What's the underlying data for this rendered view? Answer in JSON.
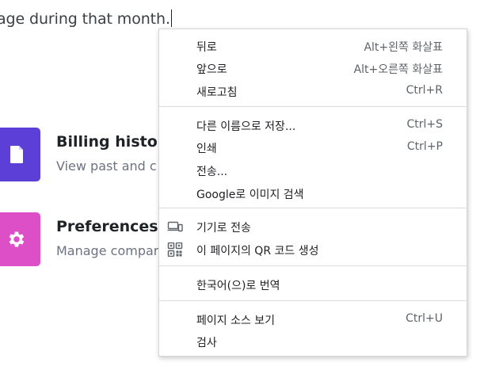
{
  "background": {
    "intro_text": "age during that month.",
    "cards": [
      {
        "title": "Billing history",
        "description": "View past and c",
        "icon": "document-icon",
        "color": "#5b3fd6"
      },
      {
        "title": "Preferences",
        "description": "Manage compar",
        "icon": "gear-icon",
        "color": "#dd4fc6"
      }
    ]
  },
  "context_menu": {
    "items": [
      {
        "label": "뒤로",
        "shortcut": "Alt+왼쪽 화살표"
      },
      {
        "label": "앞으로",
        "shortcut": "Alt+오른쪽 화살표"
      },
      {
        "label": "새로고침",
        "shortcut": "Ctrl+R"
      },
      {
        "label": "다른 이름으로 저장...",
        "shortcut": "Ctrl+S"
      },
      {
        "label": "인쇄",
        "shortcut": "Ctrl+P"
      },
      {
        "label": "전송...",
        "shortcut": ""
      },
      {
        "label": "Google로 이미지 검색",
        "shortcut": ""
      },
      {
        "label": "기기로 전송",
        "shortcut": "",
        "icon": "devices-icon"
      },
      {
        "label": "이 페이지의 QR 코드 생성",
        "shortcut": "",
        "icon": "qr-code-icon"
      },
      {
        "label": "한국어(으)로 번역",
        "shortcut": ""
      },
      {
        "label": "페이지 소스 보기",
        "shortcut": "Ctrl+U"
      },
      {
        "label": "검사",
        "shortcut": ""
      }
    ]
  }
}
